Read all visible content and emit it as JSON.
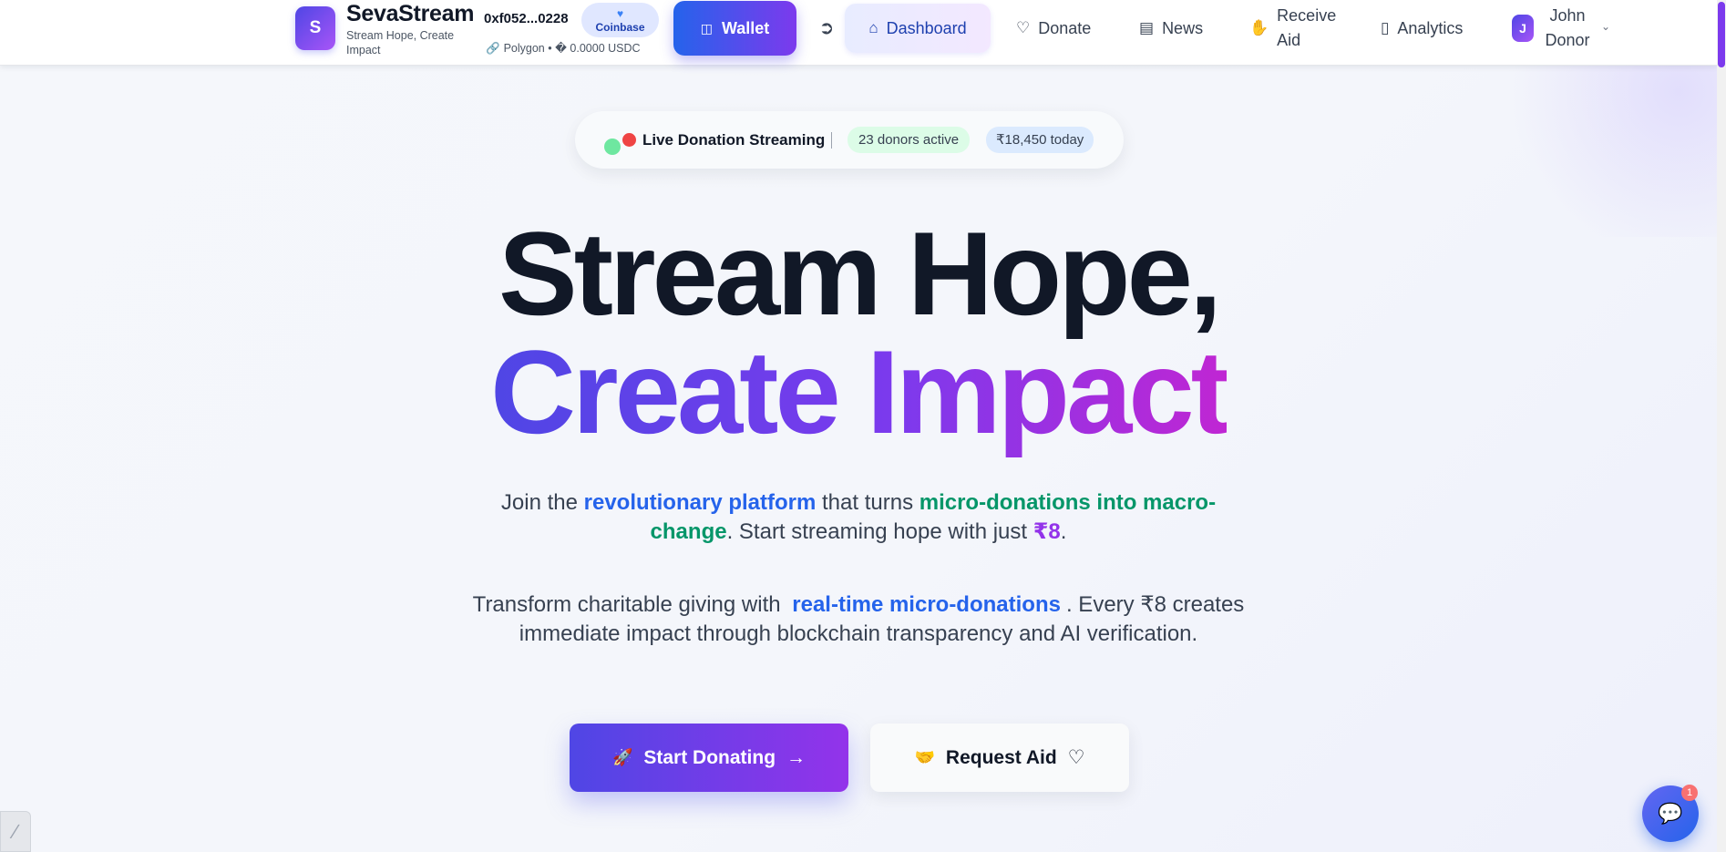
{
  "brand": {
    "logo_letter": "S",
    "name": "SevaStream",
    "tagline": "Stream Hope, Create Impact"
  },
  "wallet": {
    "address": "0xf052...0228",
    "provider_badge": "Coinbase",
    "network": "Polygon",
    "separator": "•",
    "balance": "� 0.0000 USDC",
    "button_label": "Wallet"
  },
  "nav": {
    "dashboard": "Dashboard",
    "donate": "Donate",
    "news": "News",
    "receive_aid": "Receive Aid",
    "analytics": "Analytics"
  },
  "user": {
    "initial": "J",
    "name": "John Donor"
  },
  "live": {
    "label": "Live Donation Streaming",
    "donors": "23 donors active",
    "today": "₹18,450 today"
  },
  "hero": {
    "line1": "Stream Hope,",
    "line2": "Create Impact"
  },
  "subtitle1": {
    "a": "Join the ",
    "b": "revolutionary platform",
    "c": " that turns ",
    "d": "micro-donations into macro-change",
    "e": ". Start streaming hope with just ",
    "f": "₹8",
    "g": "."
  },
  "subtitle2": {
    "a": "Transform charitable giving with ",
    "b": "real-time micro-donations",
    "c": ". Every ₹8 creates immediate impact through blockchain transparency and AI verification."
  },
  "cta": {
    "start": "Start Donating",
    "request": "Request Aid"
  },
  "chat": {
    "notification_count": "1"
  },
  "icons": {
    "wallet": "wallet-icon",
    "logout": "logout-icon",
    "dashboard": "home-icon",
    "donate": "heart-icon",
    "news": "newspaper-icon",
    "receive": "hand-coins-icon",
    "analytics": "bar-chart-icon",
    "chevron": "chevron-down-icon",
    "start": "rocket-icon",
    "arrow": "arrow-right-icon",
    "request": "handshake-icon",
    "request_heart": "heart-outline-icon",
    "chat": "chat-bubble-icon"
  },
  "colors": {
    "primary": "#4f46e5",
    "accent": "#9333ea",
    "blue_text": "#2563eb",
    "green_text": "#059669",
    "live_dot": "#ef4444"
  }
}
